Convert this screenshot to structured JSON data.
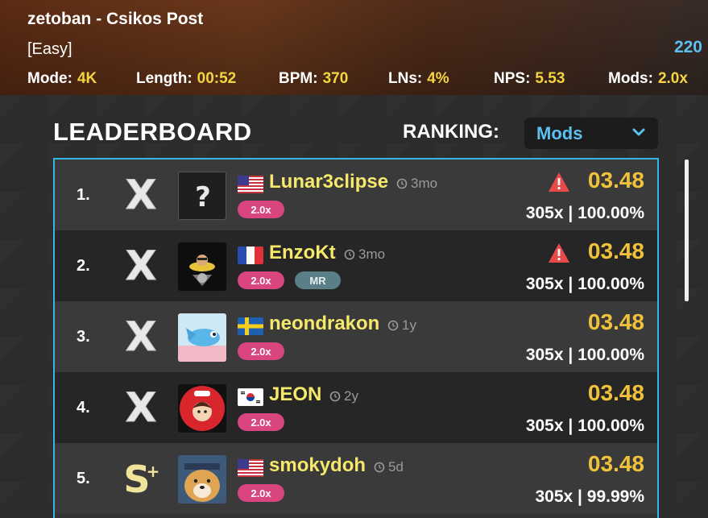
{
  "header": {
    "title": "zetoban - Csikos Post",
    "difficulty": "[Easy]",
    "score_count": "220",
    "stats": [
      {
        "label": "Mode:",
        "value": "4K"
      },
      {
        "label": "Length:",
        "value": "00:52"
      },
      {
        "label": "BPM:",
        "value": "370"
      },
      {
        "label": "LNs:",
        "value": "4%"
      },
      {
        "label": "NPS:",
        "value": "5.53"
      },
      {
        "label": "Mods:",
        "value": "2.0x"
      }
    ]
  },
  "leaderboard": {
    "title": "LEADERBOARD",
    "ranking_label": "RANKING:",
    "ranking_value": "Mods",
    "rows": [
      {
        "rank": "1.",
        "grade": "X",
        "name": "Lunar3clipse",
        "ago": "3mo",
        "flag": "us",
        "mod": "2.0x",
        "extra_badge": "",
        "warning": true,
        "rating": "03.48",
        "accuracy": "305x | 100.00%"
      },
      {
        "rank": "2.",
        "grade": "X",
        "name": "EnzoKt",
        "ago": "3mo",
        "flag": "fr",
        "mod": "2.0x",
        "extra_badge": "MR",
        "warning": true,
        "rating": "03.48",
        "accuracy": "305x | 100.00%"
      },
      {
        "rank": "3.",
        "grade": "X",
        "name": "neondrakon",
        "ago": "1y",
        "flag": "se",
        "mod": "2.0x",
        "extra_badge": "",
        "warning": false,
        "rating": "03.48",
        "accuracy": "305x | 100.00%"
      },
      {
        "rank": "4.",
        "grade": "X",
        "name": "JEON",
        "ago": "2y",
        "flag": "kr",
        "mod": "2.0x",
        "extra_badge": "",
        "warning": false,
        "rating": "03.48",
        "accuracy": "305x | 100.00%"
      },
      {
        "rank": "5.",
        "grade": "S+",
        "name": "smokydoh",
        "ago": "5d",
        "flag": "us",
        "mod": "2.0x",
        "extra_badge": "",
        "warning": false,
        "rating": "03.48",
        "accuracy": "305x | 99.99%"
      }
    ]
  },
  "colors": {
    "accent": "#35b6e6",
    "name": "#f5e86a",
    "rating": "#f0c23a",
    "mod_badge": "#d9457f",
    "warning": "#e84a4a"
  }
}
